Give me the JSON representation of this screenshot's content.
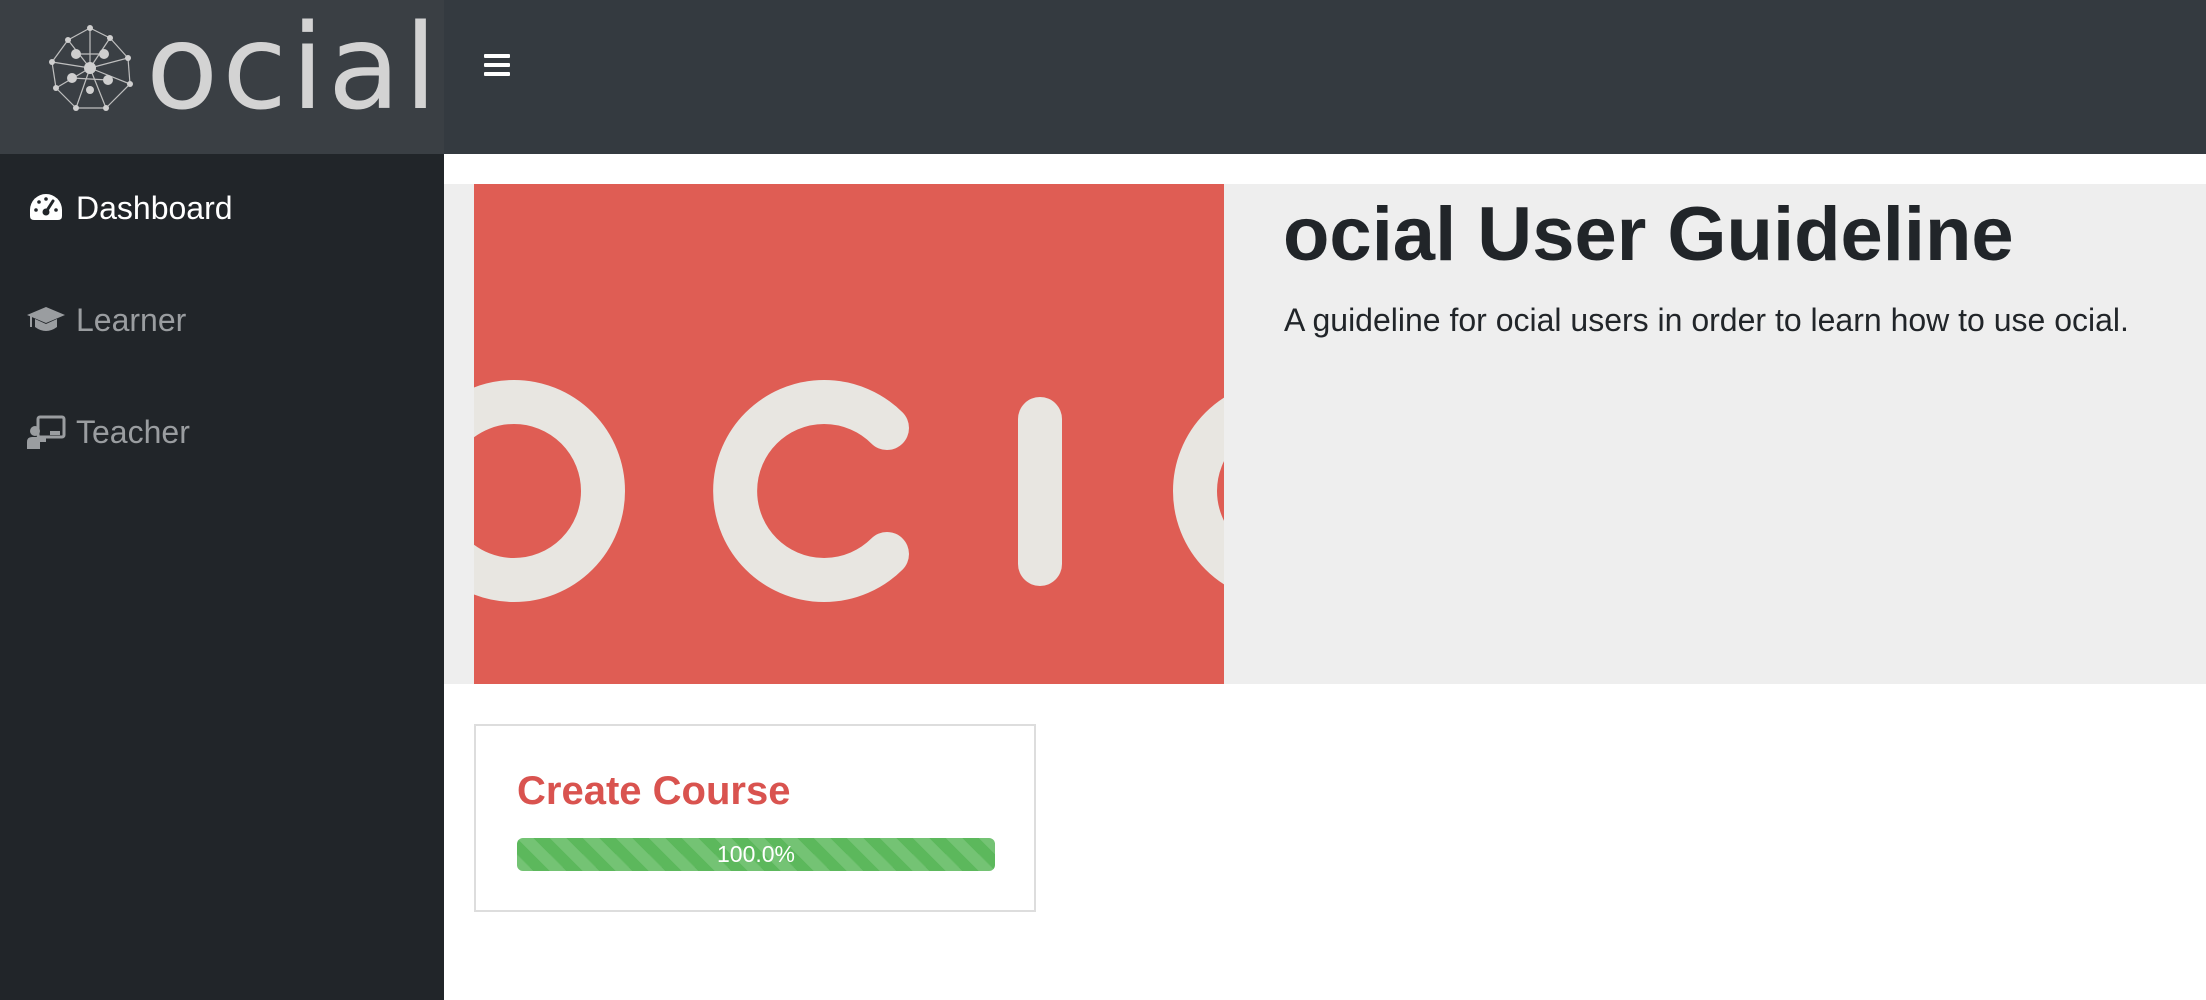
{
  "brand": {
    "logo_text": "ocial",
    "logo_icon": "network-dots-icon"
  },
  "navbar": {
    "menu_icon": "hamburger-icon"
  },
  "sidebar": {
    "items": [
      {
        "label": "Dashboard",
        "icon": "tachometer-icon",
        "active": true
      },
      {
        "label": "Learner",
        "icon": "graduation-cap-icon",
        "active": false
      },
      {
        "label": "Teacher",
        "icon": "chalkboard-teacher-icon",
        "active": false
      }
    ]
  },
  "jumbotron": {
    "image_text": "ocial",
    "title": "ocial User Guideline",
    "description": "A guideline for ocial users in order to learn how to use ocial."
  },
  "card": {
    "title": "Create Course",
    "progress_value": 1.0,
    "progress_label": "100.0%"
  },
  "colors": {
    "navbar_bg": "#343a40",
    "sidebar_bg": "#212529",
    "hero_red": "#df5d54",
    "card_title": "#d9534f",
    "progress_green": "#5cb85c",
    "jumbotron_bg": "#eeeeee"
  }
}
